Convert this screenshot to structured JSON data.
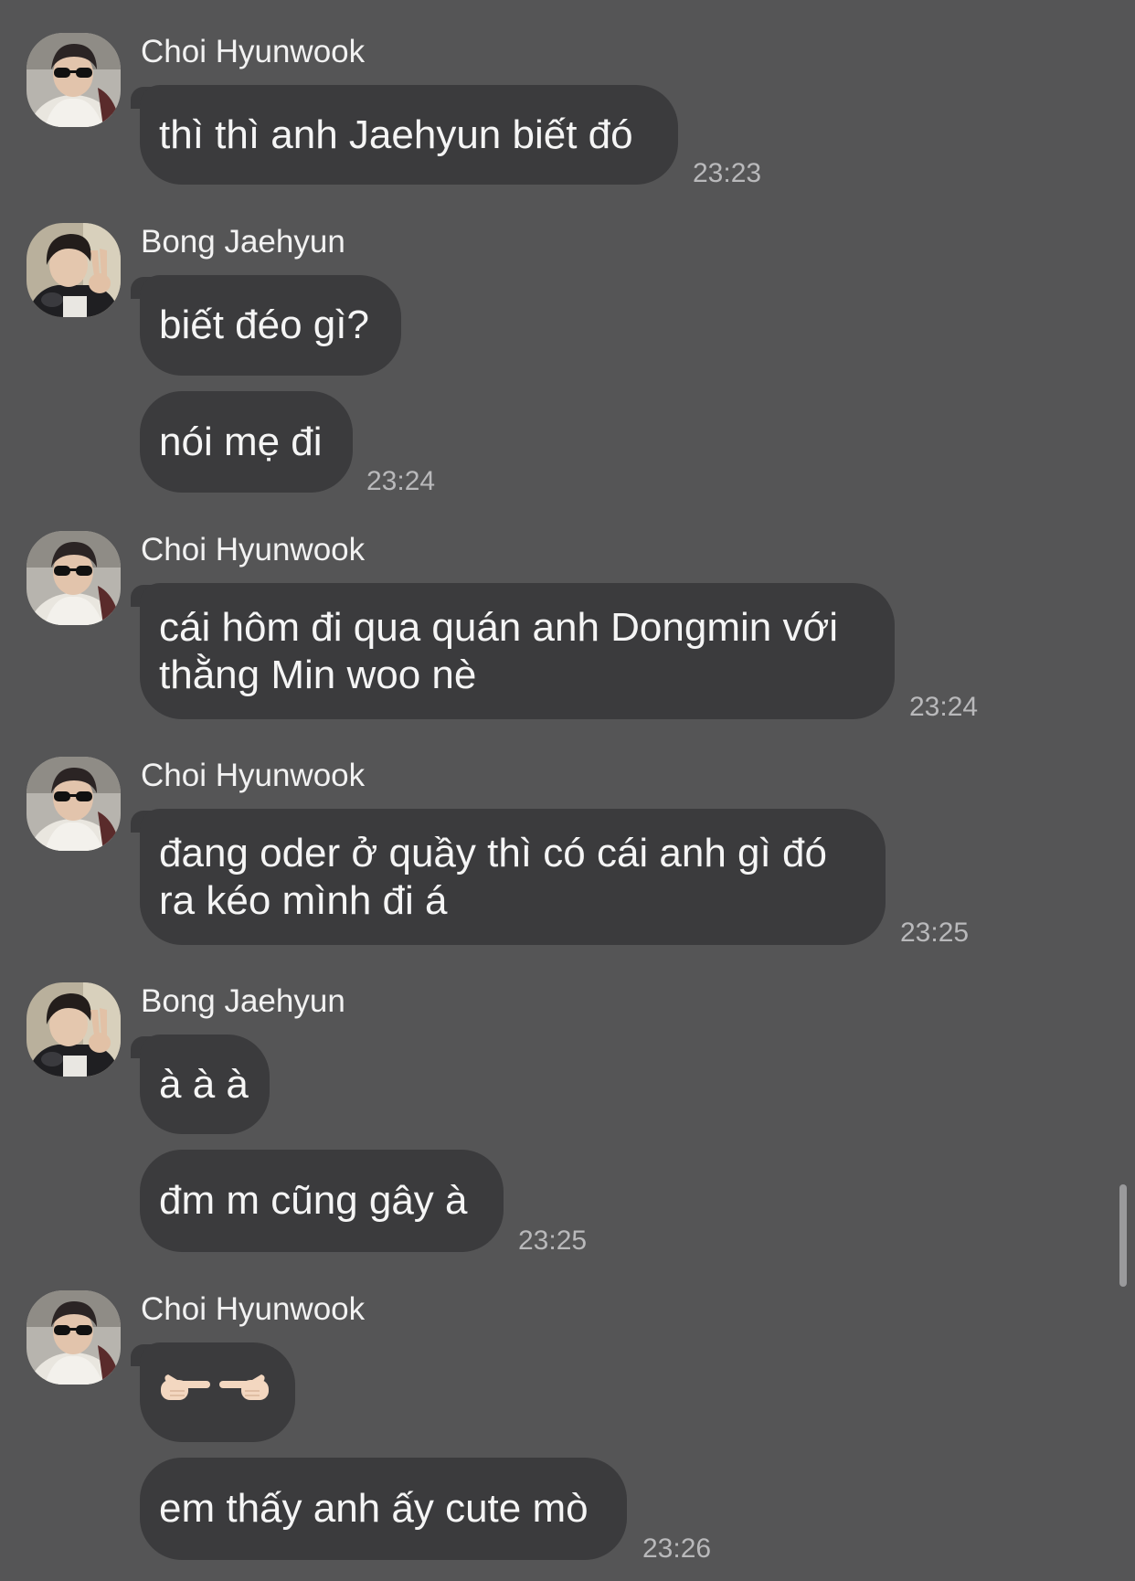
{
  "colors": {
    "background": "#555556",
    "bubble": "#3b3b3d",
    "text": "#f5f5f5",
    "time": "#b9b9bb"
  },
  "groups": [
    {
      "sender": "Choi Hyunwook",
      "avatar_icon": "sunglasses-person-avatar",
      "messages": [
        "thì thì anh Jaehyun biết đó"
      ],
      "time": "23:23"
    },
    {
      "sender": "Bong Jaehyun",
      "avatar_icon": "peace-sign-person-avatar",
      "messages": [
        "biết đéo gì?",
        "nói mẹ đi"
      ],
      "time": "23:24"
    },
    {
      "sender": "Choi Hyunwook",
      "avatar_icon": "sunglasses-person-avatar",
      "messages": [
        "cái hôm đi qua quán anh Dongmin với thằng Min woo nè"
      ],
      "time": "23:24"
    },
    {
      "sender": "Choi Hyunwook",
      "avatar_icon": "sunglasses-person-avatar",
      "messages": [
        "đang oder ở quầy thì có cái anh gì đó ra kéo mình đi á"
      ],
      "time": "23:25"
    },
    {
      "sender": "Bong Jaehyun",
      "avatar_icon": "peace-sign-person-avatar",
      "messages": [
        "à à à",
        "đm m cũng gây à"
      ],
      "time": "23:25"
    },
    {
      "sender": "Choi Hyunwook",
      "avatar_icon": "sunglasses-person-avatar",
      "messages": [
        "👉🏻👈🏻",
        "em thấy anh ấy cute mò"
      ],
      "emoji_icons": [
        "pointing-right-hand-icon",
        "pointing-left-hand-icon"
      ],
      "time": "23:26"
    }
  ]
}
